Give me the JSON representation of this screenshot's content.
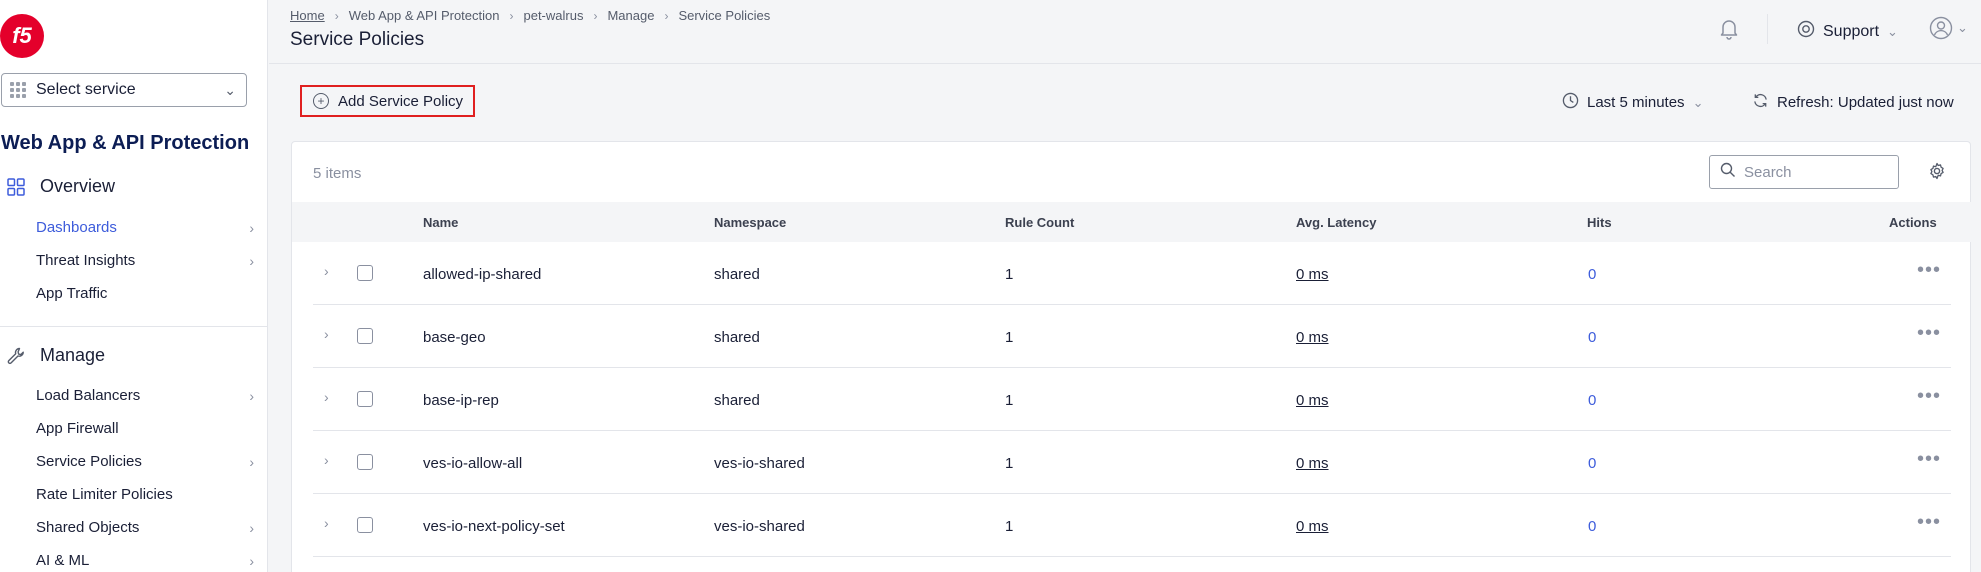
{
  "sidebar": {
    "logo_text": "f5",
    "select_service": "Select service",
    "service_title": "Web App & API Protection",
    "overview_label": "Overview",
    "overview_items": [
      {
        "label": "Dashboards",
        "active": true,
        "has_arrow": true
      },
      {
        "label": "Threat Insights",
        "active": false,
        "has_arrow": true
      },
      {
        "label": "App Traffic",
        "active": false,
        "has_arrow": false
      }
    ],
    "manage_label": "Manage",
    "manage_items": [
      {
        "label": "Load Balancers",
        "has_arrow": true
      },
      {
        "label": "App Firewall",
        "has_arrow": false
      },
      {
        "label": "Service Policies",
        "has_arrow": true
      },
      {
        "label": "Rate Limiter Policies",
        "has_arrow": false
      },
      {
        "label": "Shared Objects",
        "has_arrow": true
      },
      {
        "label": "AI & ML",
        "has_arrow": true
      }
    ]
  },
  "header": {
    "breadcrumb": [
      "Home",
      "Web App & API Protection",
      "pet-walrus",
      "Manage",
      "Service Policies"
    ],
    "title": "Service Policies",
    "support_label": "Support"
  },
  "toolbar": {
    "add_label": "Add Service Policy",
    "time_range": "Last 5 minutes",
    "refresh_label": "Refresh: Updated just now"
  },
  "table": {
    "items_count": "5 items",
    "search_placeholder": "Search",
    "columns": {
      "name": "Name",
      "namespace": "Namespace",
      "rule_count": "Rule Count",
      "latency": "Avg. Latency",
      "hits": "Hits",
      "actions": "Actions"
    },
    "rows": [
      {
        "name": "allowed-ip-shared",
        "namespace": "shared",
        "rule_count": "1",
        "latency": "0 ms",
        "hits": "0"
      },
      {
        "name": "base-geo",
        "namespace": "shared",
        "rule_count": "1",
        "latency": "0 ms",
        "hits": "0"
      },
      {
        "name": "base-ip-rep",
        "namespace": "shared",
        "rule_count": "1",
        "latency": "0 ms",
        "hits": "0"
      },
      {
        "name": "ves-io-allow-all",
        "namespace": "ves-io-shared",
        "rule_count": "1",
        "latency": "0 ms",
        "hits": "0"
      },
      {
        "name": "ves-io-next-policy-set",
        "namespace": "ves-io-shared",
        "rule_count": "1",
        "latency": "0 ms",
        "hits": "0"
      }
    ]
  },
  "colors": {
    "accent": "#3d5cdb",
    "brand": "#e4002b",
    "highlight_border": "#e02020"
  }
}
